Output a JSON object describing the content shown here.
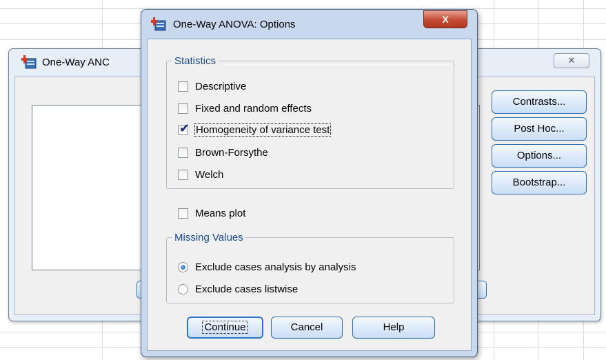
{
  "back_window": {
    "title": "One-Way ANC",
    "close_glyph": "✕",
    "buttons": [
      {
        "label": "Contrasts..."
      },
      {
        "label": "Post Hoc..."
      },
      {
        "label": "Options..."
      },
      {
        "label": "Bootstrap..."
      }
    ]
  },
  "dialog": {
    "title": "One-Way ANOVA: Options",
    "close_glyph": "X",
    "statistics": {
      "legend": "Statistics",
      "items": [
        {
          "label": "Descriptive",
          "checked": false
        },
        {
          "label": "Fixed and random effects",
          "checked": false
        },
        {
          "label": "Homogeneity of variance test",
          "checked": true
        },
        {
          "label": "Brown-Forsythe",
          "checked": false
        },
        {
          "label": "Welch",
          "checked": false
        }
      ]
    },
    "means_plot": {
      "label": "Means plot",
      "checked": false
    },
    "missing_values": {
      "legend": "Missing Values",
      "options": [
        {
          "label": "Exclude cases analysis by analysis",
          "selected": true
        },
        {
          "label": "Exclude cases listwise",
          "selected": false
        }
      ]
    },
    "buttons": {
      "continue": "Continue",
      "cancel": "Cancel",
      "help": "Help"
    },
    "check_glyph": "✔"
  }
}
